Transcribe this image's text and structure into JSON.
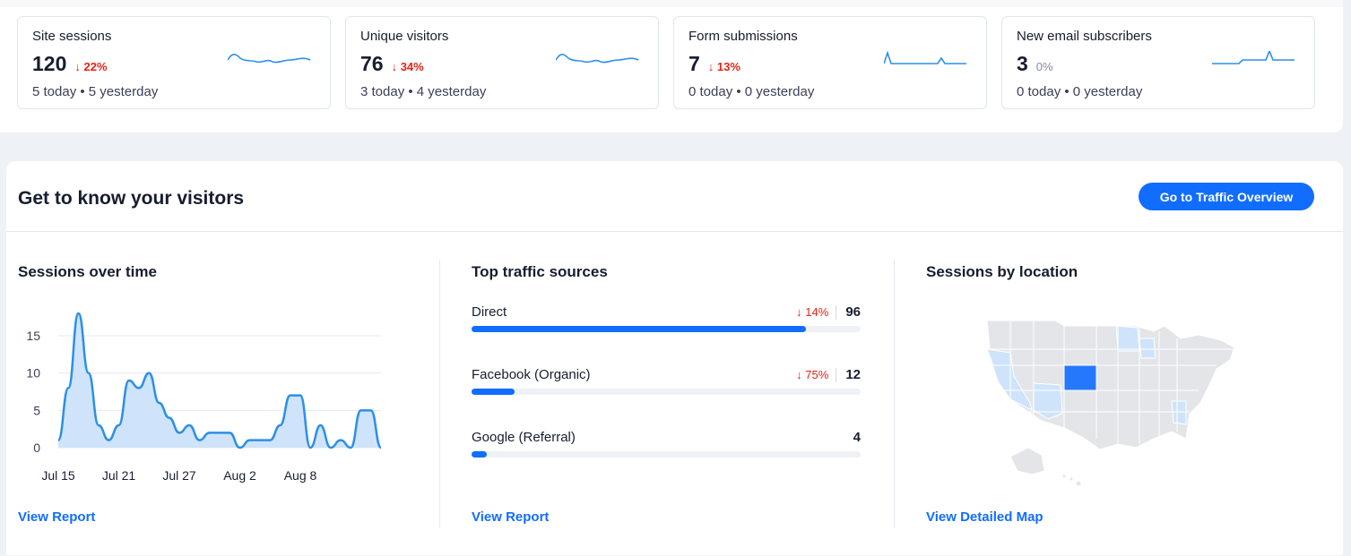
{
  "kpis": [
    {
      "label": "Site sessions",
      "value": "120",
      "change": "22%",
      "direction": "down",
      "today": "5 today",
      "yesterday": "5 yesterday"
    },
    {
      "label": "Unique visitors",
      "value": "76",
      "change": "34%",
      "direction": "down",
      "today": "3 today",
      "yesterday": "4 yesterday"
    },
    {
      "label": "Form submissions",
      "value": "7",
      "change": "13%",
      "direction": "down",
      "today": "0 today",
      "yesterday": "0 yesterday"
    },
    {
      "label": "New email subscribers",
      "value": "3",
      "change": "0%",
      "direction": "flat",
      "today": "0 today",
      "yesterday": "0 yesterday"
    }
  ],
  "visitors": {
    "title": "Get to know your visitors",
    "cta": "Go to Traffic Overview"
  },
  "sessions_chart": {
    "title": "Sessions over time",
    "link": "View Report"
  },
  "traffic_sources": {
    "title": "Top traffic sources",
    "link": "View Report",
    "items": [
      {
        "name": "Direct",
        "change": "14%",
        "count": "96",
        "share": 0.86
      },
      {
        "name": "Facebook (Organic)",
        "change": "75%",
        "count": "12",
        "share": 0.11
      },
      {
        "name": "Google (Referral)",
        "change": "",
        "count": "4",
        "share": 0.04
      }
    ]
  },
  "location": {
    "title": "Sessions by location",
    "link": "View Detailed Map"
  },
  "colors": {
    "accent": "#116dff",
    "down": "#e62214",
    "area": "#cfe4fb",
    "line": "#2d8fe8"
  },
  "chart_data": {
    "type": "area",
    "x_tick_labels": [
      "Jul 15",
      "Jul 21",
      "Jul 27",
      "Aug 2",
      "Aug 8"
    ],
    "y_ticks": [
      0,
      5,
      10,
      15
    ],
    "ylim": [
      0,
      18
    ],
    "grid": true,
    "values": [
      1,
      8,
      18,
      10,
      3,
      1,
      3,
      9,
      8,
      10,
      6,
      4,
      2,
      3,
      1,
      2,
      2,
      2,
      0,
      1,
      1,
      1,
      3,
      7,
      7,
      0,
      3,
      0,
      1,
      0,
      5,
      5,
      0
    ]
  }
}
